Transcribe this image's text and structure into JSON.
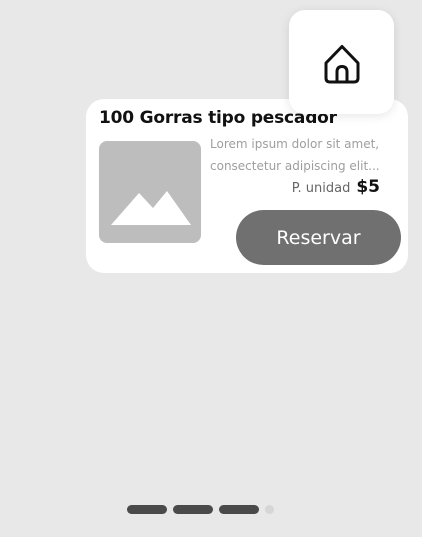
{
  "product": {
    "title": "100 Gorras tipo pescador",
    "description_line1": "Lorem ipsum dolor sit amet,",
    "description_line2": "consectetur adipiscing elit...",
    "price_label": "P. unidad",
    "price_value": "$5",
    "image_icon": "image-placeholder-icon"
  },
  "actions": {
    "reserve_label": "Reservar",
    "home_icon": "home-icon"
  },
  "pagination": {
    "total_pages": 4,
    "filled_dots": 3
  },
  "colors": {
    "background": "#e8e8e8",
    "card": "#ffffff",
    "button": "#707070",
    "image_placeholder": "#bdbdbd",
    "indicator_active": "#4a4a4a",
    "indicator_inactive": "#d6d6d6"
  }
}
